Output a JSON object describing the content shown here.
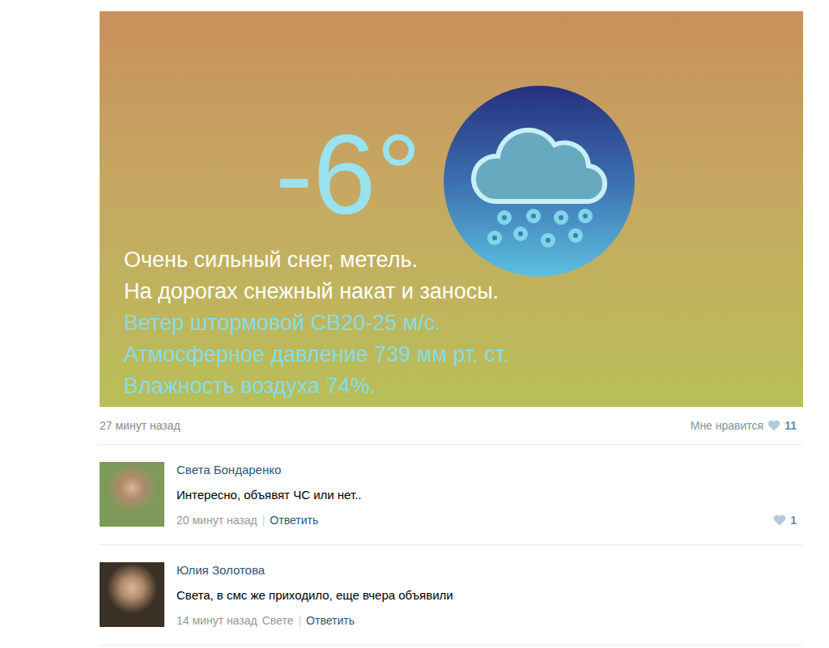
{
  "post": {
    "temperature": "-6°",
    "lines": [
      {
        "text": "Очень сильный снег, метель.",
        "color": "#ffffff"
      },
      {
        "text": "На дорогах снежный накат и заносы.",
        "color": "#ffffff"
      },
      {
        "text": "Ветер штормовой СВ20-25 м/с.",
        "color": "#86dde6"
      },
      {
        "text": "Атмосферное давление 739 мм рт. ст.",
        "color": "#86dde6"
      },
      {
        "text": "Влажность воздуха 74%.",
        "color": "#86dde6"
      }
    ],
    "time": "27 минут назад",
    "like_label": "Мне нравится",
    "likes": "11"
  },
  "comments": [
    {
      "author": "Света Бондаренко",
      "text": "Интересно, объявят ЧС или нет..",
      "time": "20 минут назад",
      "reply_to": "",
      "separator": "|",
      "reply": "Ответить",
      "likes": "1",
      "avatar_color": "#7d9a5a"
    },
    {
      "author": "Юлия Золотова",
      "text": "Света, в смс же приходило, еще вчера объявили",
      "time": "14 минут назад",
      "reply_to": "Свете",
      "separator": "|",
      "reply": "Ответить",
      "likes": "",
      "avatar_color": "#3a3024"
    }
  ]
}
